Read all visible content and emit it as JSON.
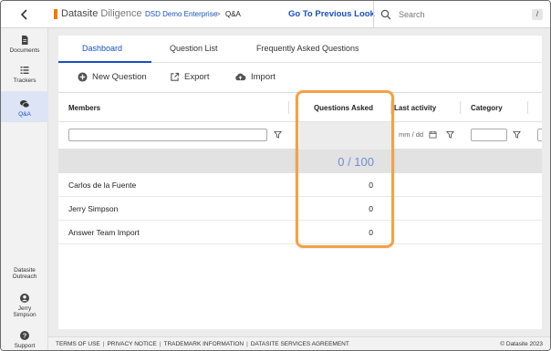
{
  "topbar": {
    "brand": "Datasite",
    "product": "Diligence",
    "breadcrumb": [
      "DSD Demo Enterprise",
      "Q&A"
    ],
    "breadcrumb_separator": ">",
    "goto_label": "Go To Previous Look",
    "search_placeholder": "Search",
    "search_shortcut": "/"
  },
  "sidebar": {
    "items": [
      {
        "label": "Documents",
        "icon": "document-icon"
      },
      {
        "label": "Trackers",
        "icon": "list-icon"
      },
      {
        "label": "Q&A",
        "icon": "chat-icon",
        "active": true
      }
    ],
    "bottom": {
      "outreach_line1": "Datasite",
      "outreach_line2": "Outreach",
      "user_line1": "Jerry",
      "user_line2": "Simpson",
      "support": "Support"
    }
  },
  "tabs": [
    "Dashboard",
    "Question List",
    "Frequently Asked Questions"
  ],
  "actions": {
    "new_question": "New Question",
    "export": "Export",
    "import": "Import"
  },
  "grid": {
    "columns": [
      "Members",
      "Questions Asked",
      "Last activity",
      "Category"
    ],
    "date_placeholder": "mm / dd",
    "summary_value": "0 / 100",
    "rows": [
      {
        "member": "Carlos de la Fuente",
        "questions": "0"
      },
      {
        "member": "Jerry Simpson",
        "questions": "0"
      },
      {
        "member": "Answer Team Import",
        "questions": "0"
      }
    ]
  },
  "footer": {
    "links": [
      "TERMS OF USE",
      "PRIVACY NOTICE",
      "TRADEMARK INFORMATION",
      "DATASITE SERVICES AGREEMENT"
    ],
    "separator": "|",
    "copyright": "© Datasite 2023"
  },
  "colors": {
    "accent": "#1a4fc0",
    "brand_orange": "#f07c00",
    "highlight": "#f3a245"
  }
}
